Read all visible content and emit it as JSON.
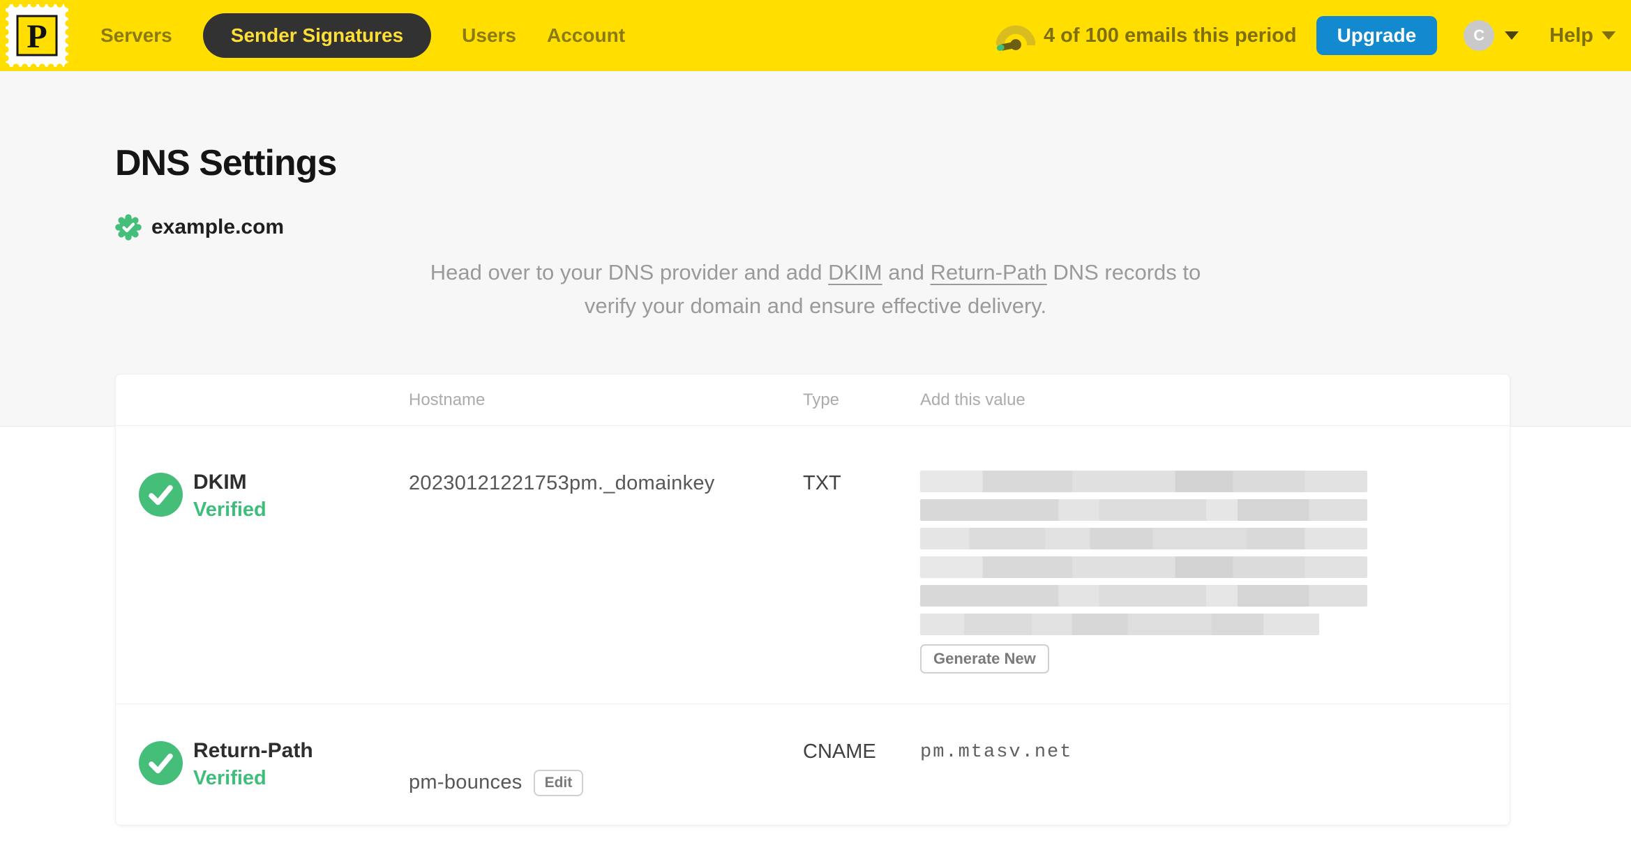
{
  "header": {
    "logo_letter": "P",
    "nav": [
      {
        "label": "Servers",
        "active": false
      },
      {
        "label": "Sender Signatures",
        "active": true
      },
      {
        "label": "Users",
        "active": false
      },
      {
        "label": "Account",
        "active": false
      }
    ],
    "usage_text": "4 of 100 emails this period",
    "upgrade_label": "Upgrade",
    "avatar_initial": "C",
    "help_label": "Help"
  },
  "page": {
    "title": "DNS Settings",
    "domain": "example.com",
    "domain_status": "verified",
    "instructions": {
      "line1_prefix": "Head over to your DNS provider and add ",
      "dkim_link": "DKIM",
      "and_text": " and ",
      "returnpath_link": "Return-Path",
      "line1_suffix": " DNS records to",
      "line2": "verify your domain and ensure effective delivery."
    }
  },
  "table": {
    "columns": [
      "Hostname",
      "Type",
      "Add this value"
    ],
    "rows": [
      {
        "name": "DKIM",
        "status": "Verified",
        "hostname": "20230121221753pm._domainkey",
        "type": "TXT",
        "value_redacted": true,
        "redacted_rows": 6,
        "action_label": "Generate New"
      },
      {
        "name": "Return-Path",
        "status": "Verified",
        "hostname": "pm-bounces",
        "hostname_action": "Edit",
        "type": "CNAME",
        "value": "pm.mtasv.net"
      }
    ]
  },
  "colors": {
    "brand_yellow": "#FFDE00",
    "nav_olive_text": "#8A7A14",
    "pill_background": "#323232",
    "pill_text": "#FFDE35",
    "upgrade_blue": "#1389CF",
    "verified_green": "#45BE7A",
    "muted_text_gray": "#9A9A9A"
  }
}
